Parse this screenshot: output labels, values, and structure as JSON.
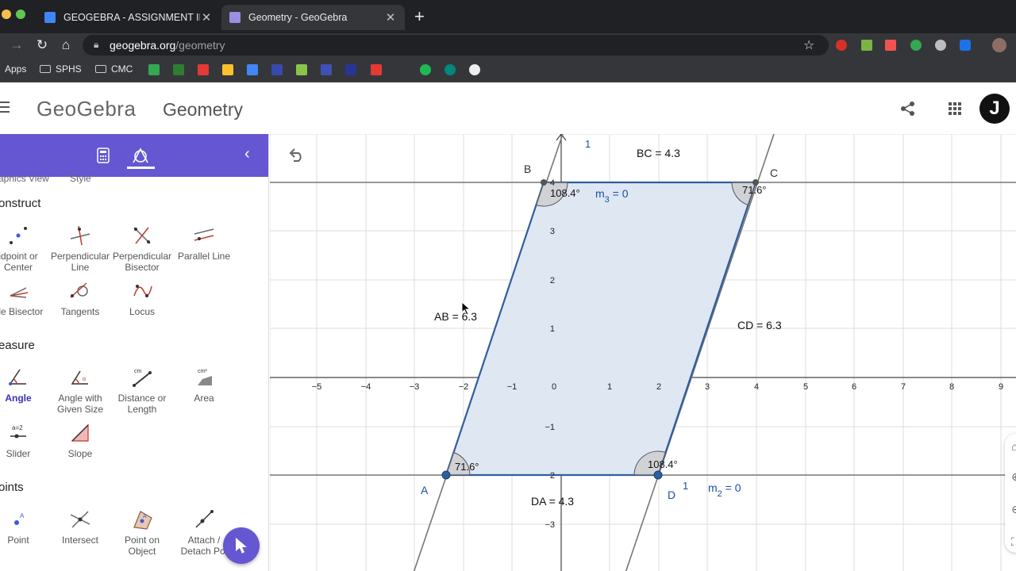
{
  "browser": {
    "tabs": [
      {
        "label": "GEOGEBRA - ASSIGNMENT IN",
        "active": false,
        "favicon_color": "#4285f4"
      },
      {
        "label": "Geometry - GeoGebra",
        "active": true,
        "favicon_color": "#9c8ee0"
      }
    ],
    "url_domain": "geogebra.org",
    "url_path": "/geometry",
    "bookmarks": [
      {
        "label": "Apps"
      },
      {
        "label": "SPHS"
      },
      {
        "label": "CMC"
      }
    ]
  },
  "header": {
    "logo": "GeoGebra",
    "title": "Geometry",
    "avatar_letter": "J"
  },
  "tools": {
    "partial_labels": [
      "aphics View",
      "Style"
    ],
    "sections": [
      {
        "title": "onstruct",
        "items": [
          {
            "label": "idpoint or Center",
            "icon": "midpoint-icon"
          },
          {
            "label": "Perpendicular Line",
            "icon": "perpendicular-line-icon"
          },
          {
            "label": "Perpendicular Bisector",
            "icon": "perpendicular-bisector-icon"
          },
          {
            "label": "Parallel Line",
            "icon": "parallel-line-icon"
          },
          {
            "label": "gle Bisector",
            "icon": "angle-bisector-icon"
          },
          {
            "label": "Tangents",
            "icon": "tangents-icon"
          },
          {
            "label": "Locus",
            "icon": "locus-icon"
          }
        ]
      },
      {
        "title": "easure",
        "items": [
          {
            "label": "Angle",
            "icon": "angle-icon",
            "selected": true
          },
          {
            "label": "Angle with Given Size",
            "icon": "angle-given-size-icon"
          },
          {
            "label": "Distance or Length",
            "icon": "distance-icon"
          },
          {
            "label": "Area",
            "icon": "area-icon"
          },
          {
            "label": "Slider",
            "icon": "slider-icon"
          },
          {
            "label": "Slope",
            "icon": "slope-icon"
          }
        ]
      },
      {
        "title": "oints",
        "items": [
          {
            "label": "Point",
            "icon": "point-icon"
          },
          {
            "label": "Intersect",
            "icon": "intersect-icon"
          },
          {
            "label": "Point on Object",
            "icon": "point-on-object-icon"
          },
          {
            "label": "Attach / Detach Poi",
            "icon": "attach-detach-icon"
          }
        ]
      }
    ]
  },
  "graphics": {
    "x_ticks": [
      "−5",
      "−4",
      "−3",
      "−2",
      "−1",
      "0",
      "1",
      "2",
      "3",
      "4",
      "5",
      "6",
      "7",
      "8",
      "9"
    ],
    "y_ticks": [
      "4",
      "3",
      "2",
      "1",
      "−1",
      "2",
      "−3"
    ],
    "points": {
      "A": "A",
      "B": "B",
      "C": "C",
      "D": "D"
    },
    "labels": {
      "AB": "AB = 6.3",
      "BC": "BC = 4.3",
      "CD": "CD = 6.3",
      "DA": "DA = 4.3",
      "angleB": "108.4°",
      "angleC": "71.6°",
      "angleA": "71.6°",
      "angleD": "108.4°",
      "m3_main": "m",
      "m3_sub": "3",
      "m3_rest": " = 0",
      "m2_main": "m",
      "m2_sub": "2",
      "m2_rest": " = 0",
      "slope_top": "1",
      "slope_bottom": "1"
    },
    "colors": {
      "fill": "#dfe7f3",
      "edge": "#2f5e9e",
      "label_blue": "#1c4fa0",
      "grid": "#d9d9d9",
      "axis": "#444444"
    }
  }
}
